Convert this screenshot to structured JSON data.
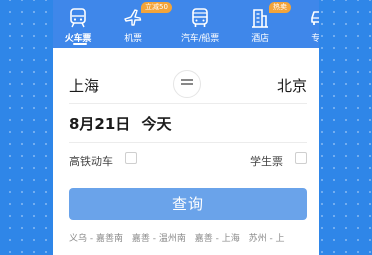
{
  "tabs": [
    {
      "name": "train",
      "label": "火车票",
      "active": true,
      "badge": ""
    },
    {
      "name": "flight",
      "label": "机票",
      "active": false,
      "badge": "立减50"
    },
    {
      "name": "bus-ship",
      "label": "汽车/船票",
      "active": false,
      "badge": ""
    },
    {
      "name": "hotel",
      "label": "酒店",
      "active": false,
      "badge": "热卖"
    },
    {
      "name": "car",
      "label": "专车",
      "active": false,
      "badge": ""
    }
  ],
  "route": {
    "from": "上海",
    "to": "北京",
    "swap_symbol": "⇌"
  },
  "date": {
    "value": "8月21日",
    "weekday": "今天"
  },
  "options": {
    "high_speed_label": "高铁动车",
    "student_label": "学生票"
  },
  "search_button": "查询",
  "history": [
    "义乌 - 嘉善南",
    "嘉善 - 温州南",
    "嘉善 - 上海",
    "苏州 - 上"
  ],
  "colors": {
    "brand_blue": "#3f87ea",
    "background_blue": "#2f86e8",
    "button_blue": "#6aa3ea",
    "badge_orange": "#f3a43a"
  }
}
